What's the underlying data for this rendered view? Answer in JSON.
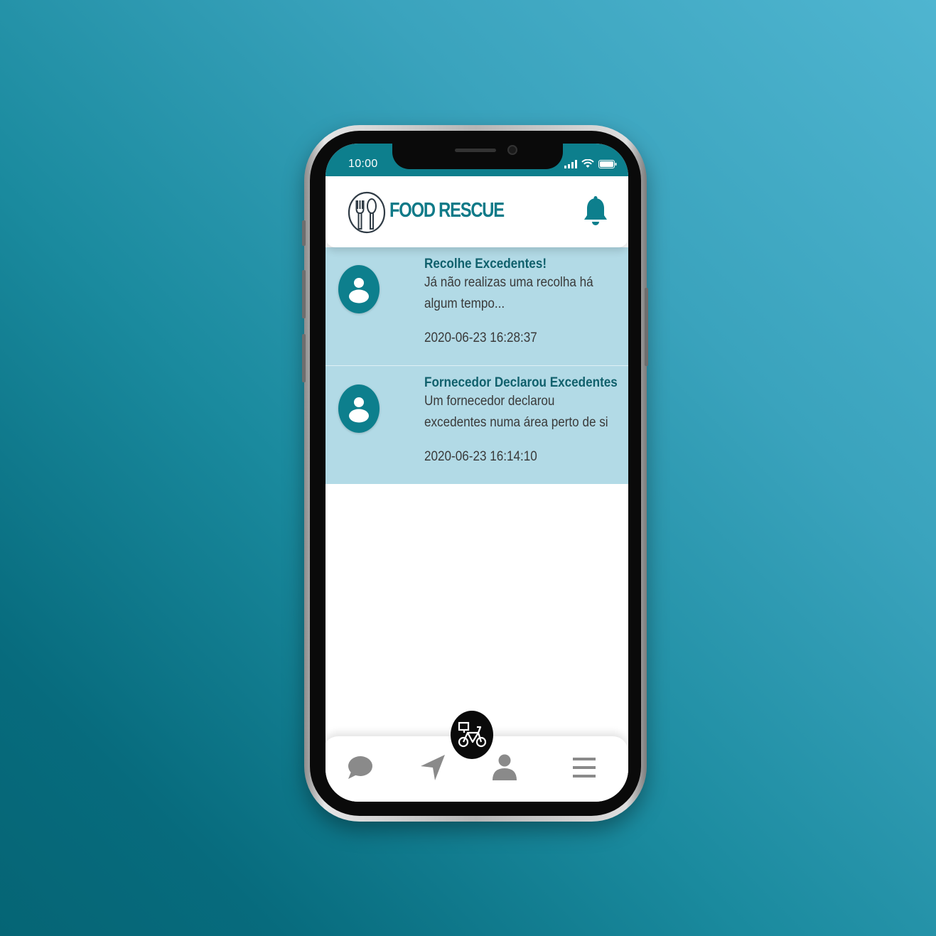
{
  "status_bar": {
    "time": "10:00",
    "icons": [
      "signal-icon",
      "wifi-icon",
      "battery-icon"
    ]
  },
  "header": {
    "logo_text": "FOOD RESCUE",
    "logo_icon": "fork-spoon-icon",
    "notification_icon": "bell-icon"
  },
  "notifications": [
    {
      "title": "Recolhe Excedentes!",
      "body": "Já não realizas uma recolha há algum tempo...",
      "timestamp": "2020-06-23 16:28:37",
      "avatar_icon": "user-avatar-icon"
    },
    {
      "title": "Fornecedor Declarou Excedentes",
      "body": "Um fornecedor declarou excedentes numa área perto de si",
      "timestamp": "2020-06-23 16:14:10",
      "avatar_icon": "user-avatar-icon"
    }
  ],
  "bottom_nav": {
    "items": [
      "chat-icon",
      "navigation-icon",
      "profile-icon",
      "menu-icon"
    ],
    "fab_icon": "delivery-bike-icon"
  },
  "colors": {
    "brand": "#0d7f8d",
    "notification_bg": "#b2dae6",
    "title_text": "#10606c",
    "nav_icon": "#8a8a8a"
  }
}
